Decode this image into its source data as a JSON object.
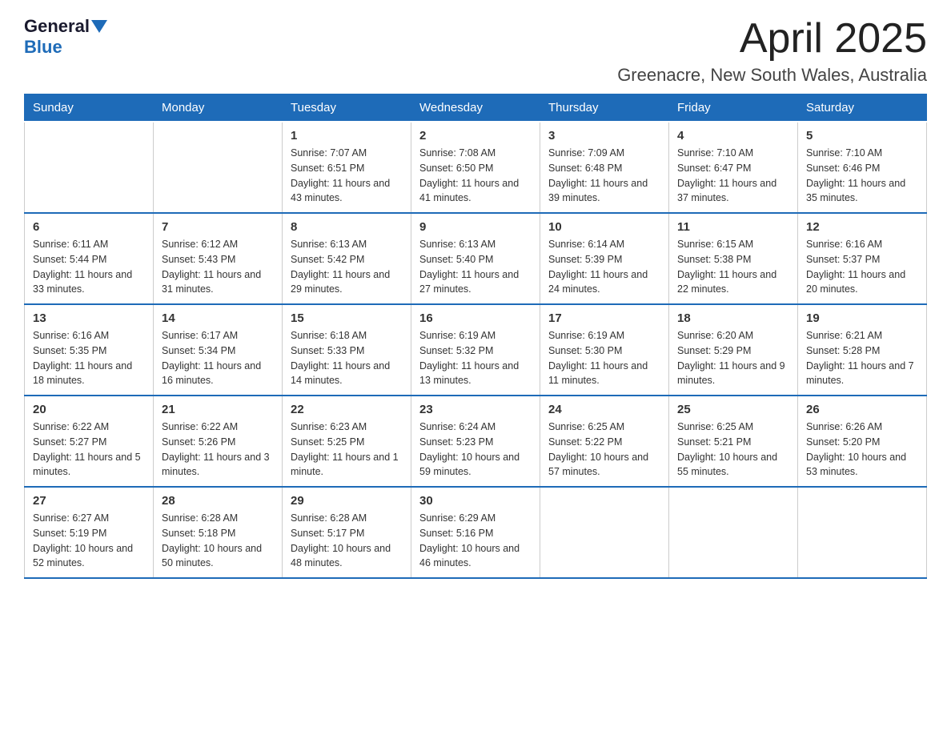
{
  "header": {
    "logo": {
      "general": "General",
      "blue": "Blue"
    },
    "month_title": "April 2025",
    "location": "Greenacre, New South Wales, Australia"
  },
  "weekdays": [
    "Sunday",
    "Monday",
    "Tuesday",
    "Wednesday",
    "Thursday",
    "Friday",
    "Saturday"
  ],
  "weeks": [
    [
      {
        "day": "",
        "sunrise": "",
        "sunset": "",
        "daylight": ""
      },
      {
        "day": "",
        "sunrise": "",
        "sunset": "",
        "daylight": ""
      },
      {
        "day": "1",
        "sunrise": "Sunrise: 7:07 AM",
        "sunset": "Sunset: 6:51 PM",
        "daylight": "Daylight: 11 hours and 43 minutes."
      },
      {
        "day": "2",
        "sunrise": "Sunrise: 7:08 AM",
        "sunset": "Sunset: 6:50 PM",
        "daylight": "Daylight: 11 hours and 41 minutes."
      },
      {
        "day": "3",
        "sunrise": "Sunrise: 7:09 AM",
        "sunset": "Sunset: 6:48 PM",
        "daylight": "Daylight: 11 hours and 39 minutes."
      },
      {
        "day": "4",
        "sunrise": "Sunrise: 7:10 AM",
        "sunset": "Sunset: 6:47 PM",
        "daylight": "Daylight: 11 hours and 37 minutes."
      },
      {
        "day": "5",
        "sunrise": "Sunrise: 7:10 AM",
        "sunset": "Sunset: 6:46 PM",
        "daylight": "Daylight: 11 hours and 35 minutes."
      }
    ],
    [
      {
        "day": "6",
        "sunrise": "Sunrise: 6:11 AM",
        "sunset": "Sunset: 5:44 PM",
        "daylight": "Daylight: 11 hours and 33 minutes."
      },
      {
        "day": "7",
        "sunrise": "Sunrise: 6:12 AM",
        "sunset": "Sunset: 5:43 PM",
        "daylight": "Daylight: 11 hours and 31 minutes."
      },
      {
        "day": "8",
        "sunrise": "Sunrise: 6:13 AM",
        "sunset": "Sunset: 5:42 PM",
        "daylight": "Daylight: 11 hours and 29 minutes."
      },
      {
        "day": "9",
        "sunrise": "Sunrise: 6:13 AM",
        "sunset": "Sunset: 5:40 PM",
        "daylight": "Daylight: 11 hours and 27 minutes."
      },
      {
        "day": "10",
        "sunrise": "Sunrise: 6:14 AM",
        "sunset": "Sunset: 5:39 PM",
        "daylight": "Daylight: 11 hours and 24 minutes."
      },
      {
        "day": "11",
        "sunrise": "Sunrise: 6:15 AM",
        "sunset": "Sunset: 5:38 PM",
        "daylight": "Daylight: 11 hours and 22 minutes."
      },
      {
        "day": "12",
        "sunrise": "Sunrise: 6:16 AM",
        "sunset": "Sunset: 5:37 PM",
        "daylight": "Daylight: 11 hours and 20 minutes."
      }
    ],
    [
      {
        "day": "13",
        "sunrise": "Sunrise: 6:16 AM",
        "sunset": "Sunset: 5:35 PM",
        "daylight": "Daylight: 11 hours and 18 minutes."
      },
      {
        "day": "14",
        "sunrise": "Sunrise: 6:17 AM",
        "sunset": "Sunset: 5:34 PM",
        "daylight": "Daylight: 11 hours and 16 minutes."
      },
      {
        "day": "15",
        "sunrise": "Sunrise: 6:18 AM",
        "sunset": "Sunset: 5:33 PM",
        "daylight": "Daylight: 11 hours and 14 minutes."
      },
      {
        "day": "16",
        "sunrise": "Sunrise: 6:19 AM",
        "sunset": "Sunset: 5:32 PM",
        "daylight": "Daylight: 11 hours and 13 minutes."
      },
      {
        "day": "17",
        "sunrise": "Sunrise: 6:19 AM",
        "sunset": "Sunset: 5:30 PM",
        "daylight": "Daylight: 11 hours and 11 minutes."
      },
      {
        "day": "18",
        "sunrise": "Sunrise: 6:20 AM",
        "sunset": "Sunset: 5:29 PM",
        "daylight": "Daylight: 11 hours and 9 minutes."
      },
      {
        "day": "19",
        "sunrise": "Sunrise: 6:21 AM",
        "sunset": "Sunset: 5:28 PM",
        "daylight": "Daylight: 11 hours and 7 minutes."
      }
    ],
    [
      {
        "day": "20",
        "sunrise": "Sunrise: 6:22 AM",
        "sunset": "Sunset: 5:27 PM",
        "daylight": "Daylight: 11 hours and 5 minutes."
      },
      {
        "day": "21",
        "sunrise": "Sunrise: 6:22 AM",
        "sunset": "Sunset: 5:26 PM",
        "daylight": "Daylight: 11 hours and 3 minutes."
      },
      {
        "day": "22",
        "sunrise": "Sunrise: 6:23 AM",
        "sunset": "Sunset: 5:25 PM",
        "daylight": "Daylight: 11 hours and 1 minute."
      },
      {
        "day": "23",
        "sunrise": "Sunrise: 6:24 AM",
        "sunset": "Sunset: 5:23 PM",
        "daylight": "Daylight: 10 hours and 59 minutes."
      },
      {
        "day": "24",
        "sunrise": "Sunrise: 6:25 AM",
        "sunset": "Sunset: 5:22 PM",
        "daylight": "Daylight: 10 hours and 57 minutes."
      },
      {
        "day": "25",
        "sunrise": "Sunrise: 6:25 AM",
        "sunset": "Sunset: 5:21 PM",
        "daylight": "Daylight: 10 hours and 55 minutes."
      },
      {
        "day": "26",
        "sunrise": "Sunrise: 6:26 AM",
        "sunset": "Sunset: 5:20 PM",
        "daylight": "Daylight: 10 hours and 53 minutes."
      }
    ],
    [
      {
        "day": "27",
        "sunrise": "Sunrise: 6:27 AM",
        "sunset": "Sunset: 5:19 PM",
        "daylight": "Daylight: 10 hours and 52 minutes."
      },
      {
        "day": "28",
        "sunrise": "Sunrise: 6:28 AM",
        "sunset": "Sunset: 5:18 PM",
        "daylight": "Daylight: 10 hours and 50 minutes."
      },
      {
        "day": "29",
        "sunrise": "Sunrise: 6:28 AM",
        "sunset": "Sunset: 5:17 PM",
        "daylight": "Daylight: 10 hours and 48 minutes."
      },
      {
        "day": "30",
        "sunrise": "Sunrise: 6:29 AM",
        "sunset": "Sunset: 5:16 PM",
        "daylight": "Daylight: 10 hours and 46 minutes."
      },
      {
        "day": "",
        "sunrise": "",
        "sunset": "",
        "daylight": ""
      },
      {
        "day": "",
        "sunrise": "",
        "sunset": "",
        "daylight": ""
      },
      {
        "day": "",
        "sunrise": "",
        "sunset": "",
        "daylight": ""
      }
    ]
  ]
}
